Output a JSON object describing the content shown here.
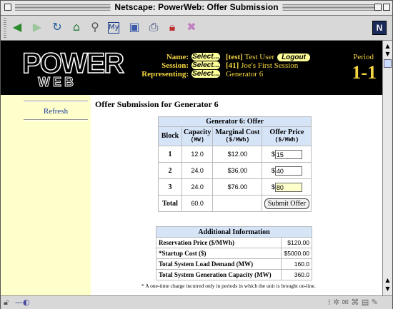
{
  "window": {
    "title": "Netscape: PowerWeb: Offer Submission"
  },
  "toolbar": {
    "icons": [
      "back-icon",
      "forward-icon",
      "reload-icon",
      "home-icon",
      "search-icon",
      "mynetscape-icon",
      "images-icon",
      "print-icon",
      "security-icon",
      "stop-icon"
    ],
    "logo_letter": "N"
  },
  "header": {
    "logo_top": "POWER",
    "logo_bottom": "WEB",
    "name_label": "Name:",
    "session_label": "Session:",
    "representing_label": "Representing:",
    "select_label": "Select...",
    "name_value_tag": "[test]",
    "name_value": " Test User",
    "logout_label": "Logout",
    "session_value_tag": "[41]",
    "session_value": " Joe's First Session",
    "representing_value": "Generator 6",
    "period_label": "Period",
    "period_value": "1-1"
  },
  "sidebar": {
    "refresh_label": "Refresh"
  },
  "main": {
    "title": "Offer Submission for Generator 6"
  },
  "offer_table": {
    "caption": "Generator 6: Offer",
    "headers": [
      "Block",
      "Capacity",
      "Marginal Cost",
      "Offer Price"
    ],
    "units": [
      "",
      "(MW)",
      "($/MWh)",
      "($/MWh)"
    ],
    "rows": [
      {
        "block": "1",
        "capacity": "12.0",
        "cost": "$12.00",
        "price": "15"
      },
      {
        "block": "2",
        "capacity": "24.0",
        "cost": "$36.00",
        "price": "40"
      },
      {
        "block": "3",
        "capacity": "24.0",
        "cost": "$76.00",
        "price": "80"
      }
    ],
    "total_label": "Total",
    "total_capacity": "60.0",
    "currency": "$",
    "submit_label": "Submit Offer"
  },
  "info_table": {
    "caption": "Additional Information",
    "rows": [
      {
        "label": "Reservation Price ($/MWh)",
        "value": "$120.00"
      },
      {
        "label": "*Startup Cost ($)",
        "value": "$5000.00"
      },
      {
        "label": "Total System Load Demand (MW)",
        "value": "160.0"
      },
      {
        "label": "Total System Generation Capacity (MW)",
        "value": "360.0"
      }
    ],
    "footnote": "* A one-time charge incurred only in periods in which the unit is brought on-line."
  },
  "colors": {
    "header_bg": "#000000",
    "header_text": "#f5d742",
    "sidebar_bg": "#ffffcc",
    "table_header_bg": "#d6e4f8"
  }
}
